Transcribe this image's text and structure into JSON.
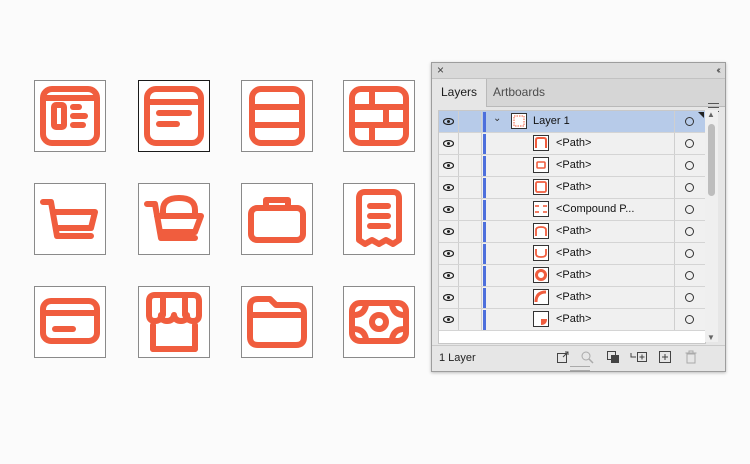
{
  "artboards": [
    {
      "icon": "layout-dashboard-icon",
      "selected": false
    },
    {
      "icon": "browser-window-icon",
      "selected": true
    },
    {
      "icon": "stacked-rows-icon",
      "selected": false
    },
    {
      "icon": "brick-grid-icon",
      "selected": false
    },
    {
      "icon": "shopping-cart-icon",
      "selected": false
    },
    {
      "icon": "basket-cart-icon",
      "selected": false
    },
    {
      "icon": "shopping-bag-icon",
      "selected": false
    },
    {
      "icon": "receipt-icon",
      "selected": false
    },
    {
      "icon": "credit-card-icon",
      "selected": false
    },
    {
      "icon": "store-awning-icon",
      "selected": false
    },
    {
      "icon": "folder-icon",
      "selected": false
    },
    {
      "icon": "banknote-icon",
      "selected": false
    }
  ],
  "colors": {
    "accent": "#f05d3e",
    "layer_color": "#4d6fdc",
    "selection": "#b7cbe9"
  },
  "panel": {
    "close_glyph": "×",
    "collapse_glyph": "‹‹",
    "tabs": [
      {
        "label": "Layers",
        "active": true
      },
      {
        "label": "Artboards",
        "active": false
      }
    ],
    "layer_name": "Layer 1",
    "expand_glyph": "⌄",
    "rows": [
      {
        "label": "<Path>",
        "thumb": "half-top"
      },
      {
        "label": "<Path>",
        "thumb": "inner-square"
      },
      {
        "label": "<Path>",
        "thumb": "frame"
      },
      {
        "label": "<Compound P...",
        "thumb": "dashes"
      },
      {
        "label": "<Path>",
        "thumb": "arch"
      },
      {
        "label": "<Path>",
        "thumb": "cup"
      },
      {
        "label": "<Path>",
        "thumb": "ring"
      },
      {
        "label": "<Path>",
        "thumb": "quarter-ring"
      },
      {
        "label": "<Path>",
        "thumb": "quarter-solid"
      }
    ],
    "scroll_up": "▲",
    "scroll_down": "▼",
    "footer_count": "1 Layer",
    "footer_tools": [
      "export-icon",
      "locate-icon",
      "clipping-mask-icon",
      "new-sublayer-icon",
      "new-layer-icon",
      "trash-icon"
    ]
  }
}
